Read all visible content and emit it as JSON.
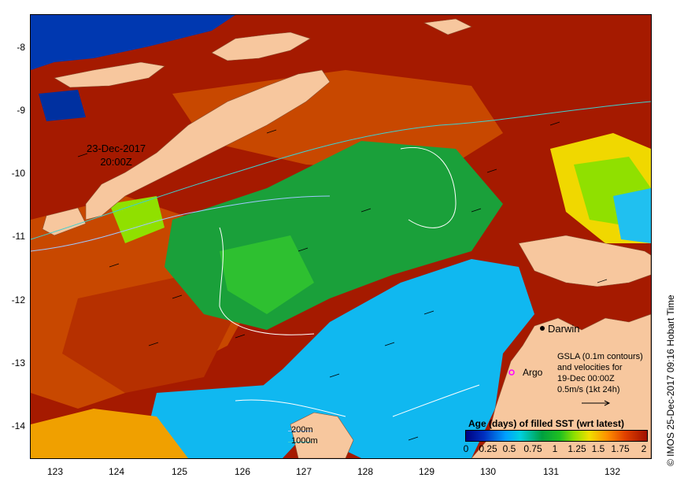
{
  "map": {
    "timestamp_line1": "23-Dec-2017",
    "timestamp_line2": "20:00Z",
    "city": "Darwin",
    "argo": "Argo",
    "gsla_text": [
      "GSLA (0.1m contours)",
      "and velocities for",
      "19-Dec 00:00Z",
      "0.5m/s (1kt 24h)"
    ],
    "contour_key": [
      "200m",
      "1000m"
    ],
    "credit": "© IMOS 25-Dec-2017 09:16 Hobart Time",
    "x_ticks": [
      "123",
      "124",
      "125",
      "126",
      "127",
      "128",
      "129",
      "130",
      "131",
      "132"
    ],
    "y_ticks": [
      "-8",
      "-9",
      "-10",
      "-11",
      "-12",
      "-13",
      "-14"
    ]
  },
  "legend": {
    "title": "Age (days) of filled SST (wrt latest)",
    "ticks": [
      "0",
      "0.25",
      "0.5",
      "0.75",
      "1",
      "1.25",
      "1.5",
      "1.75",
      "2"
    ]
  },
  "colors": {
    "land": "#f7c79e",
    "sst_old": "#a51a00",
    "sst_mid": "#c84800",
    "sst_green": "#1aa03a",
    "sst_cyan": "#10b8f0",
    "sst_yellow": "#f0d800",
    "sst_blue": "#0038b0",
    "contour_200m": "#a0c8ff",
    "contour_1000m": "#40d0d0"
  }
}
